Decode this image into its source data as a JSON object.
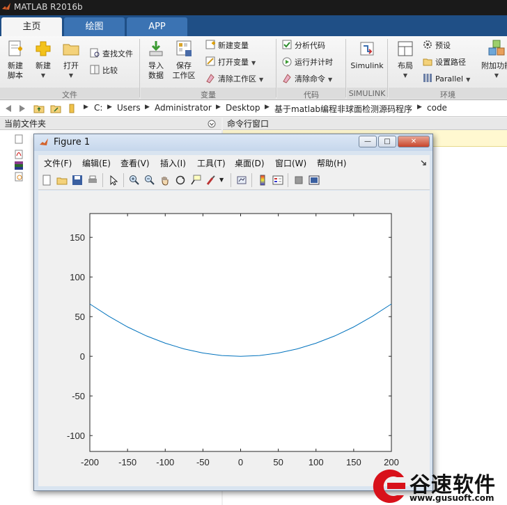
{
  "app": {
    "title": "MATLAB R2016b"
  },
  "tabs": [
    {
      "label": "主页"
    },
    {
      "label": "绘图"
    },
    {
      "label": "APP"
    }
  ],
  "ribbon": {
    "file": {
      "new_script": "新建\n脚本",
      "new": "新建",
      "open": "打开",
      "find_files": "查找文件",
      "compare": "比较",
      "group_label": "文件"
    },
    "variable": {
      "import": "导入\n数据",
      "save_ws": "保存\n工作区",
      "new_var": "新建变量",
      "open_var": "打开变量",
      "clear_ws": "清除工作区",
      "group_label": "变量"
    },
    "code": {
      "analyze": "分析代码",
      "run_time": "运行并计时",
      "clear_cmd": "清除命令",
      "group_label": "代码"
    },
    "simulink": {
      "label": "Simulink",
      "group_label": "SIMULINK"
    },
    "env": {
      "layout": "布局",
      "prefs": "预设",
      "set_path": "设置路径",
      "parallel": "Parallel",
      "addons": "附加功能",
      "group_label": "环境"
    }
  },
  "address": {
    "path": [
      "C:",
      "Users",
      "Administrator",
      "Desktop",
      "基于matlab编程非球面检测源码程序",
      "code"
    ]
  },
  "panels": {
    "current_folder": "当前文件夹",
    "command_window": "命令行窗口"
  },
  "figure": {
    "title": "Figure 1",
    "menu": [
      "文件(F)",
      "编辑(E)",
      "查看(V)",
      "插入(I)",
      "工具(T)",
      "桌面(D)",
      "窗口(W)",
      "帮助(H)"
    ]
  },
  "chart_data": {
    "type": "line",
    "title": "",
    "xlabel": "",
    "ylabel": "",
    "xlim": [
      -200,
      200
    ],
    "ylim": [
      -120,
      180
    ],
    "xticks": [
      -200,
      -150,
      -100,
      -50,
      0,
      50,
      100,
      150,
      200
    ],
    "yticks": [
      -100,
      -50,
      0,
      50,
      100,
      150
    ],
    "grid": false,
    "series": [
      {
        "color": "#0072bd",
        "x": [
          -200,
          -175,
          -150,
          -125,
          -100,
          -75,
          -50,
          -25,
          0,
          25,
          50,
          75,
          100,
          125,
          150,
          175,
          200
        ],
        "y": [
          66,
          50.5,
          37,
          25.7,
          16.5,
          9.3,
          4.1,
          1,
          0,
          1,
          4.1,
          9.3,
          16.5,
          25.7,
          37,
          50.5,
          66
        ]
      }
    ]
  },
  "watermark": {
    "brand": "谷速软件",
    "url": "www.gusuoft.com"
  }
}
